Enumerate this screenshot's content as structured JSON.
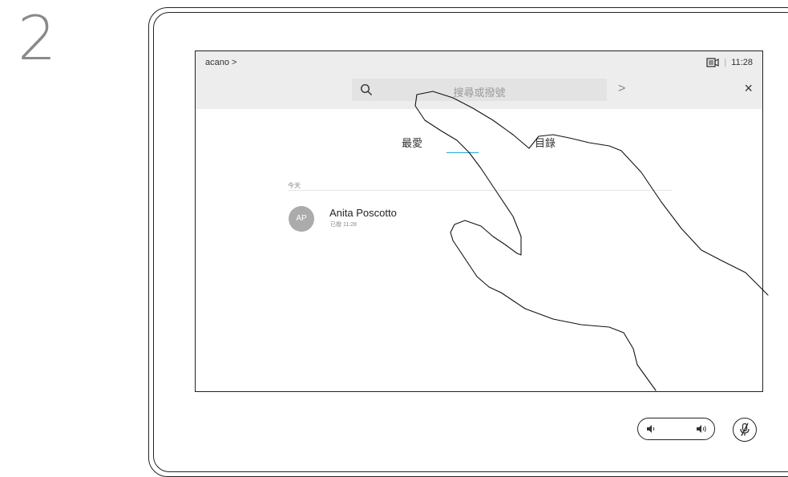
{
  "step": {
    "number": "2"
  },
  "top_bar": {
    "brand": "acano >",
    "time": "11:28",
    "separator": "|",
    "search_placeholder": "搜尋或撥號",
    "go_glyph": ">",
    "close_glyph": "×"
  },
  "tabs": {
    "favorites_label": "最愛",
    "recent_label": "目錄"
  },
  "recents": {
    "section_label": "今天",
    "items": [
      {
        "initials": "AP",
        "name": "Anita Poscotto",
        "detail": "已撥 11:28"
      }
    ]
  },
  "icons": {
    "camera": "camera-icon",
    "search": "search-icon",
    "hand": "hand-gesture-icon",
    "volume_down": "volume-down-icon",
    "volume_up": "volume-up-icon",
    "mute": "microphone-mute-icon"
  },
  "colors": {
    "accent": "#1fa7d6",
    "topbar_bg": "#ededed",
    "avatar_bg": "#ababab"
  }
}
